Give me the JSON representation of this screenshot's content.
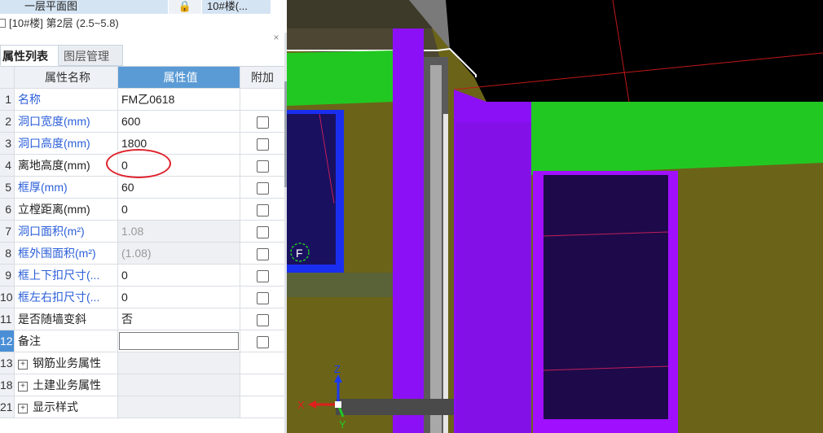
{
  "top_panel": {
    "floor_cell": "一层平面图",
    "building_cell": "10#楼(...",
    "tree_row": "[10#楼] 第2层 (2.5~5.8)",
    "close_symbol": "×"
  },
  "tabs": [
    {
      "label": "属性列表",
      "active": true
    },
    {
      "label": "图层管理",
      "active": false
    }
  ],
  "grid": {
    "headers": {
      "name": "属性名称",
      "value": "属性值",
      "extra": "附加"
    },
    "rows": [
      {
        "idx": "1",
        "name": "名称",
        "value": "FM乙0618",
        "checkbox": false
      },
      {
        "idx": "2",
        "name": "洞口宽度(mm)",
        "value": "600",
        "checkbox": true
      },
      {
        "idx": "3",
        "name": "洞口高度(mm)",
        "value": "1800",
        "checkbox": true
      },
      {
        "idx": "4",
        "name": "离地高度(mm)",
        "value": "0",
        "checkbox": true
      },
      {
        "idx": "5",
        "name": "框厚(mm)",
        "value": "60",
        "checkbox": true
      },
      {
        "idx": "6",
        "name": "立樘距离(mm)",
        "value": "0",
        "checkbox": true
      },
      {
        "idx": "7",
        "name": "洞口面积(m²)",
        "value": "1.08",
        "checkbox": true
      },
      {
        "idx": "8",
        "name": "框外围面积(m²)",
        "value": "(1.08)",
        "checkbox": true
      },
      {
        "idx": "9",
        "name": "框上下扣尺寸(...",
        "value": "0",
        "checkbox": true
      },
      {
        "idx": "10",
        "name": "框左右扣尺寸(...",
        "value": "0",
        "checkbox": true
      },
      {
        "idx": "11",
        "name": "是否随墙变斜",
        "value": "否",
        "checkbox": true
      },
      {
        "idx": "12",
        "name": "备注",
        "value": "",
        "checkbox": true
      }
    ],
    "groups": [
      {
        "idx": "13",
        "label": "钢筋业务属性"
      },
      {
        "idx": "18",
        "label": "土建业务属性"
      },
      {
        "idx": "21",
        "label": "显示样式"
      }
    ]
  },
  "viewport": {
    "marker_label": "F",
    "axis_labels": {
      "x": "X",
      "y": "Y",
      "z": "Z"
    },
    "colors": {
      "wall": "#6b6418",
      "beam": "#22c822",
      "column": "#8c10f5",
      "slab": "#000000",
      "frame_blue": "#1a2ef0"
    }
  }
}
